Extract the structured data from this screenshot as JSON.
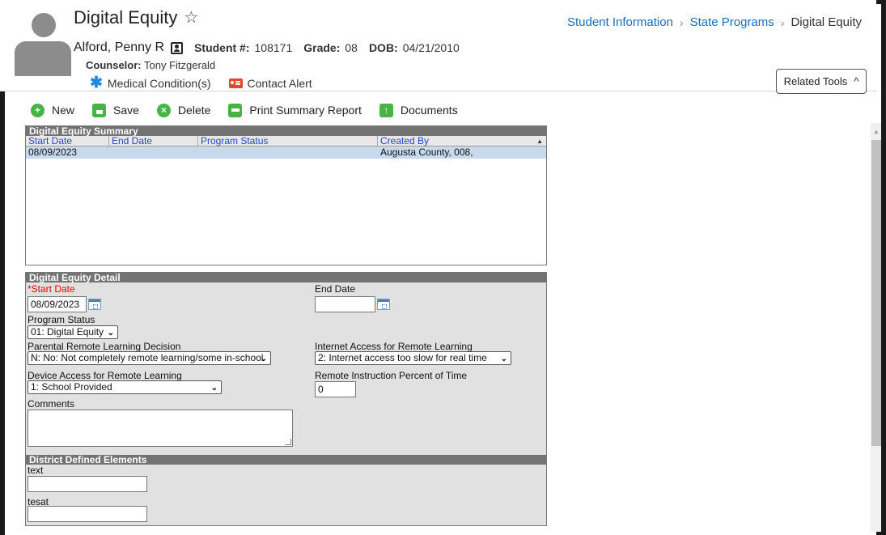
{
  "header": {
    "title": "Digital Equity",
    "student_name": "Alford, Penny R",
    "student_num_label": "Student #:",
    "student_num": "108171",
    "grade_label": "Grade:",
    "grade": "08",
    "dob_label": "DOB:",
    "dob": "04/21/2010",
    "counselor_label": "Counselor:",
    "counselor": "Tony Fitzgerald",
    "medical_label": "Medical Condition(s)",
    "contact_alert_label": "Contact Alert",
    "related_tools_label": "Related Tools"
  },
  "breadcrumb": {
    "items": [
      "Student Information",
      "State Programs",
      "Digital Equity"
    ]
  },
  "toolbar": {
    "new_label": "New",
    "save_label": "Save",
    "delete_label": "Delete",
    "print_label": "Print Summary Report",
    "documents_label": "Documents"
  },
  "summary": {
    "title": "Digital Equity Summary",
    "columns": [
      "Start Date",
      "End Date",
      "Program Status",
      "Created By"
    ],
    "rows": [
      {
        "start_date": "08/09/2023",
        "end_date": "",
        "program_status": "",
        "created_by": "Augusta County, 008,"
      }
    ]
  },
  "detail": {
    "title": "Digital Equity Detail",
    "start_date_label": "*Start Date",
    "start_date_value": "08/09/2023",
    "end_date_label": "End Date",
    "end_date_value": "",
    "program_status_label": "Program Status",
    "program_status_value": "01: Digital Equity",
    "parental_label": "Parental Remote Learning Decision",
    "parental_value": "N: No: Not completely remote learning/some in-school",
    "internet_label": "Internet Access for Remote Learning",
    "internet_value": "2: Internet access too slow for real time",
    "device_label": "Device Access for Remote Learning",
    "device_value": "1: School Provided",
    "remote_pct_label": "Remote Instruction Percent of Time",
    "remote_pct_value": "0",
    "comments_label": "Comments",
    "comments_value": ""
  },
  "district": {
    "title": "District Defined Elements",
    "field1_label": "text",
    "field1_value": "",
    "field2_label": "tesat",
    "field2_value": ""
  },
  "colors": {
    "link_blue": "#1d6fb8",
    "toolbar_green": "#46b344",
    "panel_header": "#737373",
    "selected_row": "#c8d9ec",
    "required_red": "#e00000"
  }
}
